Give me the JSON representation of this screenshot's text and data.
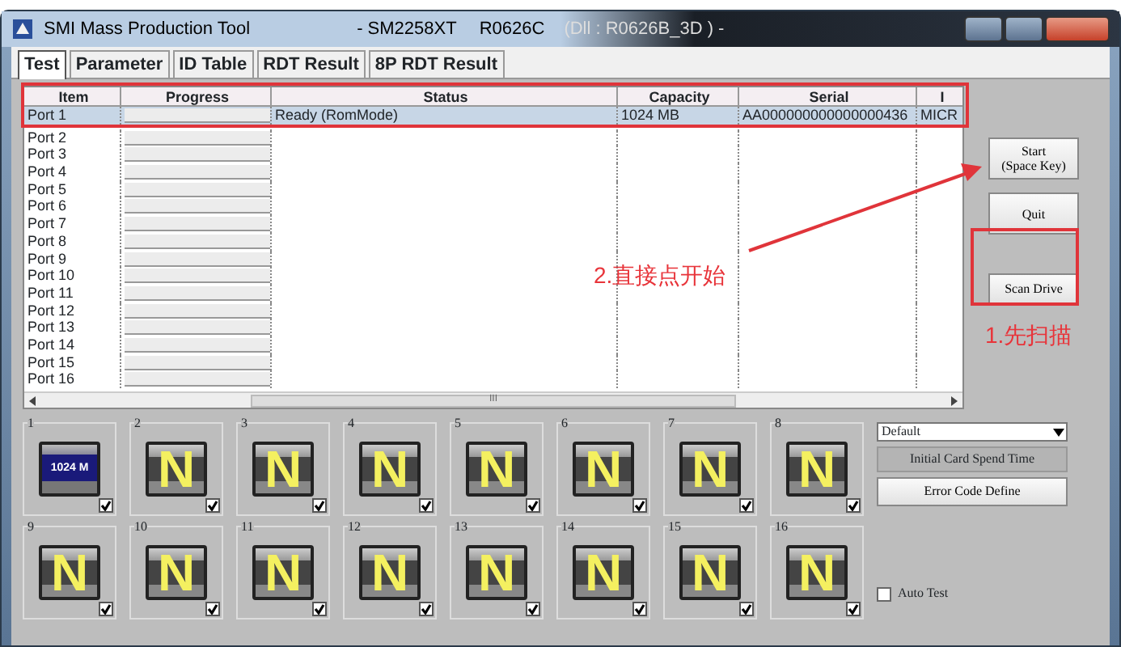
{
  "window": {
    "title": "SMI Mass Production Tool",
    "controller": "- SM2258XT",
    "version": "R0626C",
    "dll": "(Dll : R0626B_3D ) -"
  },
  "tabs": [
    {
      "label": "Test",
      "selected": true
    },
    {
      "label": "Parameter",
      "selected": false
    },
    {
      "label": "ID Table",
      "selected": false
    },
    {
      "label": "RDT Result",
      "selected": false
    },
    {
      "label": "8P RDT Result",
      "selected": false
    }
  ],
  "table": {
    "columns": [
      "Item",
      "Progress",
      "Status",
      "Capacity",
      "Serial",
      "I"
    ],
    "rows": [
      {
        "item": "Port 1",
        "level": 0,
        "status": "Ready (RomMode)",
        "capacity": "1024 MB",
        "serial": "AA000000000000000436",
        "column_6": "MICR",
        "selected": true
      },
      {
        "item": "Port 2",
        "level": 0,
        "selected": false
      },
      {
        "item": "Port 3",
        "level": 0,
        "selected": false
      },
      {
        "item": "Port 4",
        "level": 0,
        "selected": false
      },
      {
        "item": "Port 5",
        "level": 0,
        "selected": false
      },
      {
        "item": "Port 6",
        "level": 0,
        "selected": false
      },
      {
        "item": "Port 7",
        "level": 0,
        "selected": false
      },
      {
        "item": "Port 8",
        "level": 0,
        "selected": false
      },
      {
        "item": "Port 9",
        "level": 0,
        "selected": false
      },
      {
        "item": "Port 10",
        "level": 0,
        "selected": false
      },
      {
        "item": "Port 11",
        "level": 0,
        "selected": false
      },
      {
        "item": "Port 12",
        "level": 0,
        "selected": false
      },
      {
        "item": "Port 13",
        "level": 0,
        "selected": false
      },
      {
        "item": "Port 14",
        "level": 0,
        "selected": false
      },
      {
        "item": "Port 15",
        "level": 0,
        "selected": false
      },
      {
        "item": "Port 16",
        "level": 0,
        "selected": false
      }
    ],
    "scroll_mark": "III"
  },
  "buttons": [
    "Start\n(Space Key)",
    "Quit",
    "Scan Drive"
  ],
  "ports": [
    {
      "number": "1",
      "kind": "capacity",
      "display": "1024 M",
      "checked": true
    },
    {
      "number": "2",
      "kind": "none",
      "display": "N",
      "checked": true
    },
    {
      "number": "3",
      "kind": "none",
      "display": "N",
      "checked": true
    },
    {
      "number": "4",
      "kind": "none",
      "display": "N",
      "checked": true
    },
    {
      "number": "5",
      "kind": "none",
      "display": "N",
      "checked": true
    },
    {
      "number": "6",
      "kind": "none",
      "display": "N",
      "checked": true
    },
    {
      "number": "7",
      "kind": "none",
      "display": "N",
      "checked": true
    },
    {
      "number": "8",
      "kind": "none",
      "display": "N",
      "checked": true
    },
    {
      "number": "9",
      "kind": "none",
      "display": "N",
      "checked": true
    },
    {
      "number": "10",
      "kind": "none",
      "display": "N",
      "checked": true
    },
    {
      "number": "11",
      "kind": "none",
      "display": "N",
      "checked": true
    },
    {
      "number": "12",
      "kind": "none",
      "display": "N",
      "checked": true
    },
    {
      "number": "13",
      "kind": "none",
      "display": "N",
      "checked": true
    },
    {
      "number": "14",
      "kind": "none",
      "display": "N",
      "checked": true
    },
    {
      "number": "15",
      "kind": "none",
      "display": "N",
      "checked": true
    },
    {
      "number": "16",
      "kind": "none",
      "display": "N",
      "checked": true
    }
  ],
  "settings": {
    "profile": "Default",
    "spend_time_button": "Initial Card Spend Time",
    "error_code_button": "Error Code Define",
    "auto_test": {
      "label": "Auto Test",
      "checked": false
    }
  },
  "annotations": {
    "start_note": "2.直接点开始",
    "scan_note": "1.先扫描"
  }
}
